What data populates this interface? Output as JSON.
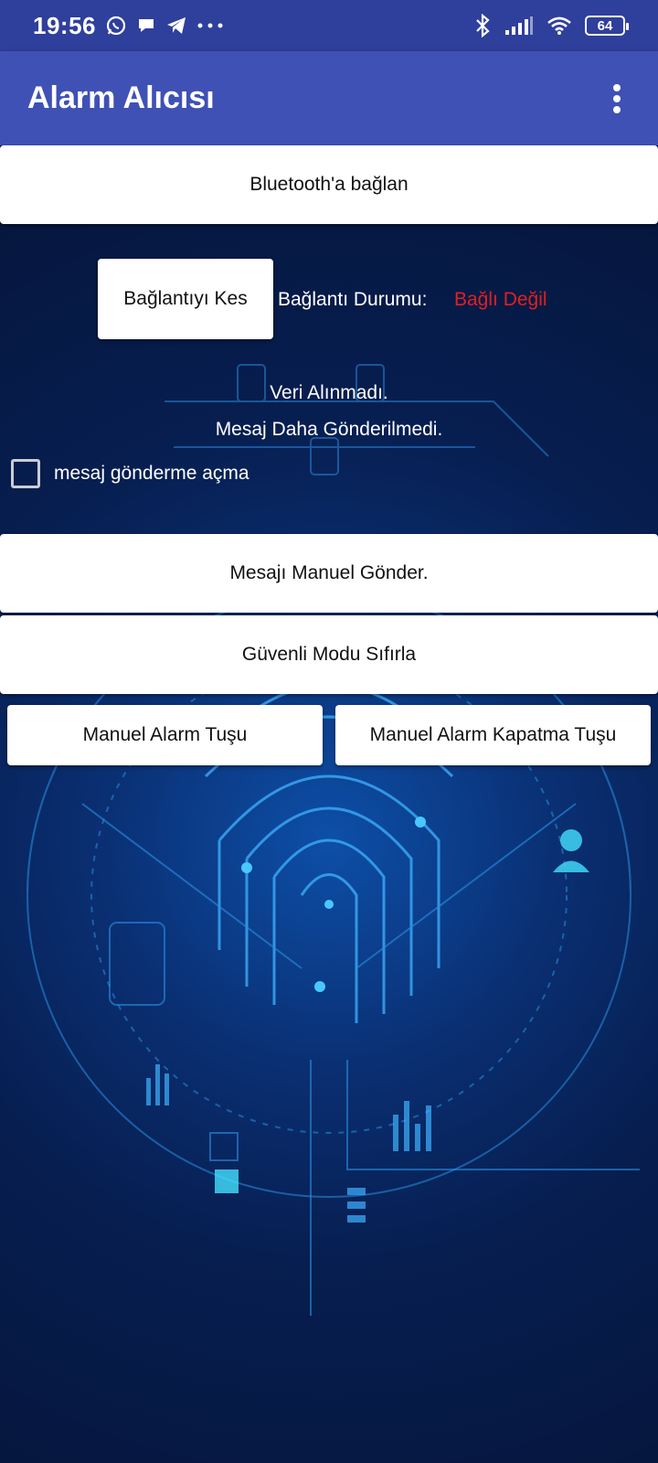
{
  "status_bar": {
    "time": "19:56",
    "icons_left": [
      "whatsapp-icon",
      "chat-bubble-icon",
      "telegram-icon",
      "more-dots-icon"
    ],
    "icons_right": [
      "bluetooth-icon",
      "signal-icon",
      "wifi-icon"
    ],
    "battery": "64"
  },
  "app_bar": {
    "title": "Alarm Alıcısı",
    "menu_icon": "overflow-menu-icon"
  },
  "buttons": {
    "connect": "Bluetooth'a bağlan",
    "disconnect": "Bağlantıyı Kes",
    "send_manual": "Mesajı Manuel Gönder.",
    "reset_safe_mode": "Güvenli Modu Sıfırla",
    "manual_alarm": "Manuel Alarm Tuşu",
    "manual_alarm_off": "Manuel Alarm Kapatma Tuşu"
  },
  "connection": {
    "label": "Bağlantı Durumu:",
    "status": "Bağlı Değil",
    "status_color": "#e02020"
  },
  "messages": {
    "data_status": "Veri Alınmadı.",
    "message_status": "Mesaj Daha Gönderilmedi."
  },
  "checkbox": {
    "label": "mesaj gönderme açma",
    "checked": false
  },
  "colors": {
    "status_bar": "#2f3f9c",
    "app_bar": "#3f51b5",
    "background": "#061a44"
  }
}
